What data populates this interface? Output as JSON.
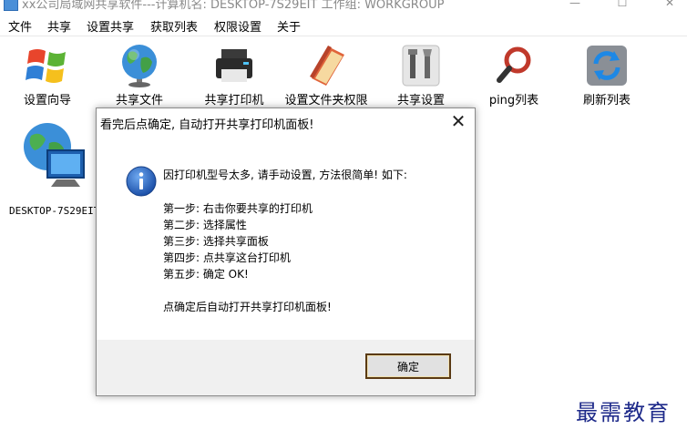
{
  "window": {
    "title": "xx公司局域网共享软件---计算机名: DESKTOP-7S29EIT  工作组: WORKGROUP"
  },
  "menu": [
    "文件",
    "共享",
    "设置共享",
    "获取列表",
    "权限设置",
    "关于"
  ],
  "toolbar": [
    {
      "label": "设置向导",
      "icon": "windows-logo-icon"
    },
    {
      "label": "共享文件",
      "icon": "globe-icon"
    },
    {
      "label": "共享打印机",
      "icon": "printer-icon"
    },
    {
      "label": "设置文件夹权限",
      "icon": "folder-icon"
    },
    {
      "label": "共享设置",
      "icon": "tools-icon"
    },
    {
      "label": "ping列表",
      "icon": "magnifier-icon"
    },
    {
      "label": "刷新列表",
      "icon": "refresh-icon"
    }
  ],
  "computers": [
    {
      "label": "DESKTOP-7S29EIT"
    }
  ],
  "dialog": {
    "title": "看完后点确定, 自动打开共享打印机面板!",
    "lines": [
      "因打印机型号太多, 请手动设置, 方法很简单! 如下:",
      "第一步: 右击你要共享的打印机",
      "第二步: 选择属性",
      "第三步: 选择共享面板",
      "第四步: 点共享这台打印机",
      "第五步: 确定  OK!",
      "点确定后自动打开共享打印机面板!"
    ],
    "ok_label": "确定"
  },
  "watermark": "最需教育"
}
